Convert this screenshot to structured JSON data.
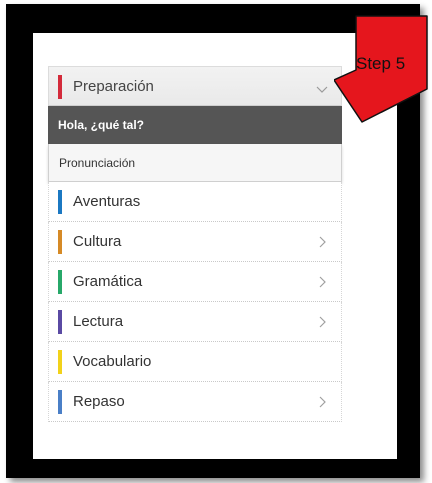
{
  "menu": {
    "header": {
      "label": "Preparación",
      "color": "#d32a3a"
    },
    "sub_items": [
      {
        "label": "Hola, ¿qué tal?",
        "active": true
      },
      {
        "label": "Pronunciación",
        "active": false
      }
    ],
    "items": [
      {
        "label": "Aventuras",
        "color": "#1b78c2",
        "chevron": false
      },
      {
        "label": "Cultura",
        "color": "#d68a26",
        "chevron": true
      },
      {
        "label": "Gramática",
        "color": "#27a869",
        "chevron": true
      },
      {
        "label": "Lectura",
        "color": "#5a4aa3",
        "chevron": true
      },
      {
        "label": "Vocabulario",
        "color": "#f2d21a",
        "chevron": false
      },
      {
        "label": "Repaso",
        "color": "#4a7fc7",
        "chevron": true
      }
    ]
  },
  "callout": {
    "label": "Step 5",
    "color": "#e5161d"
  }
}
